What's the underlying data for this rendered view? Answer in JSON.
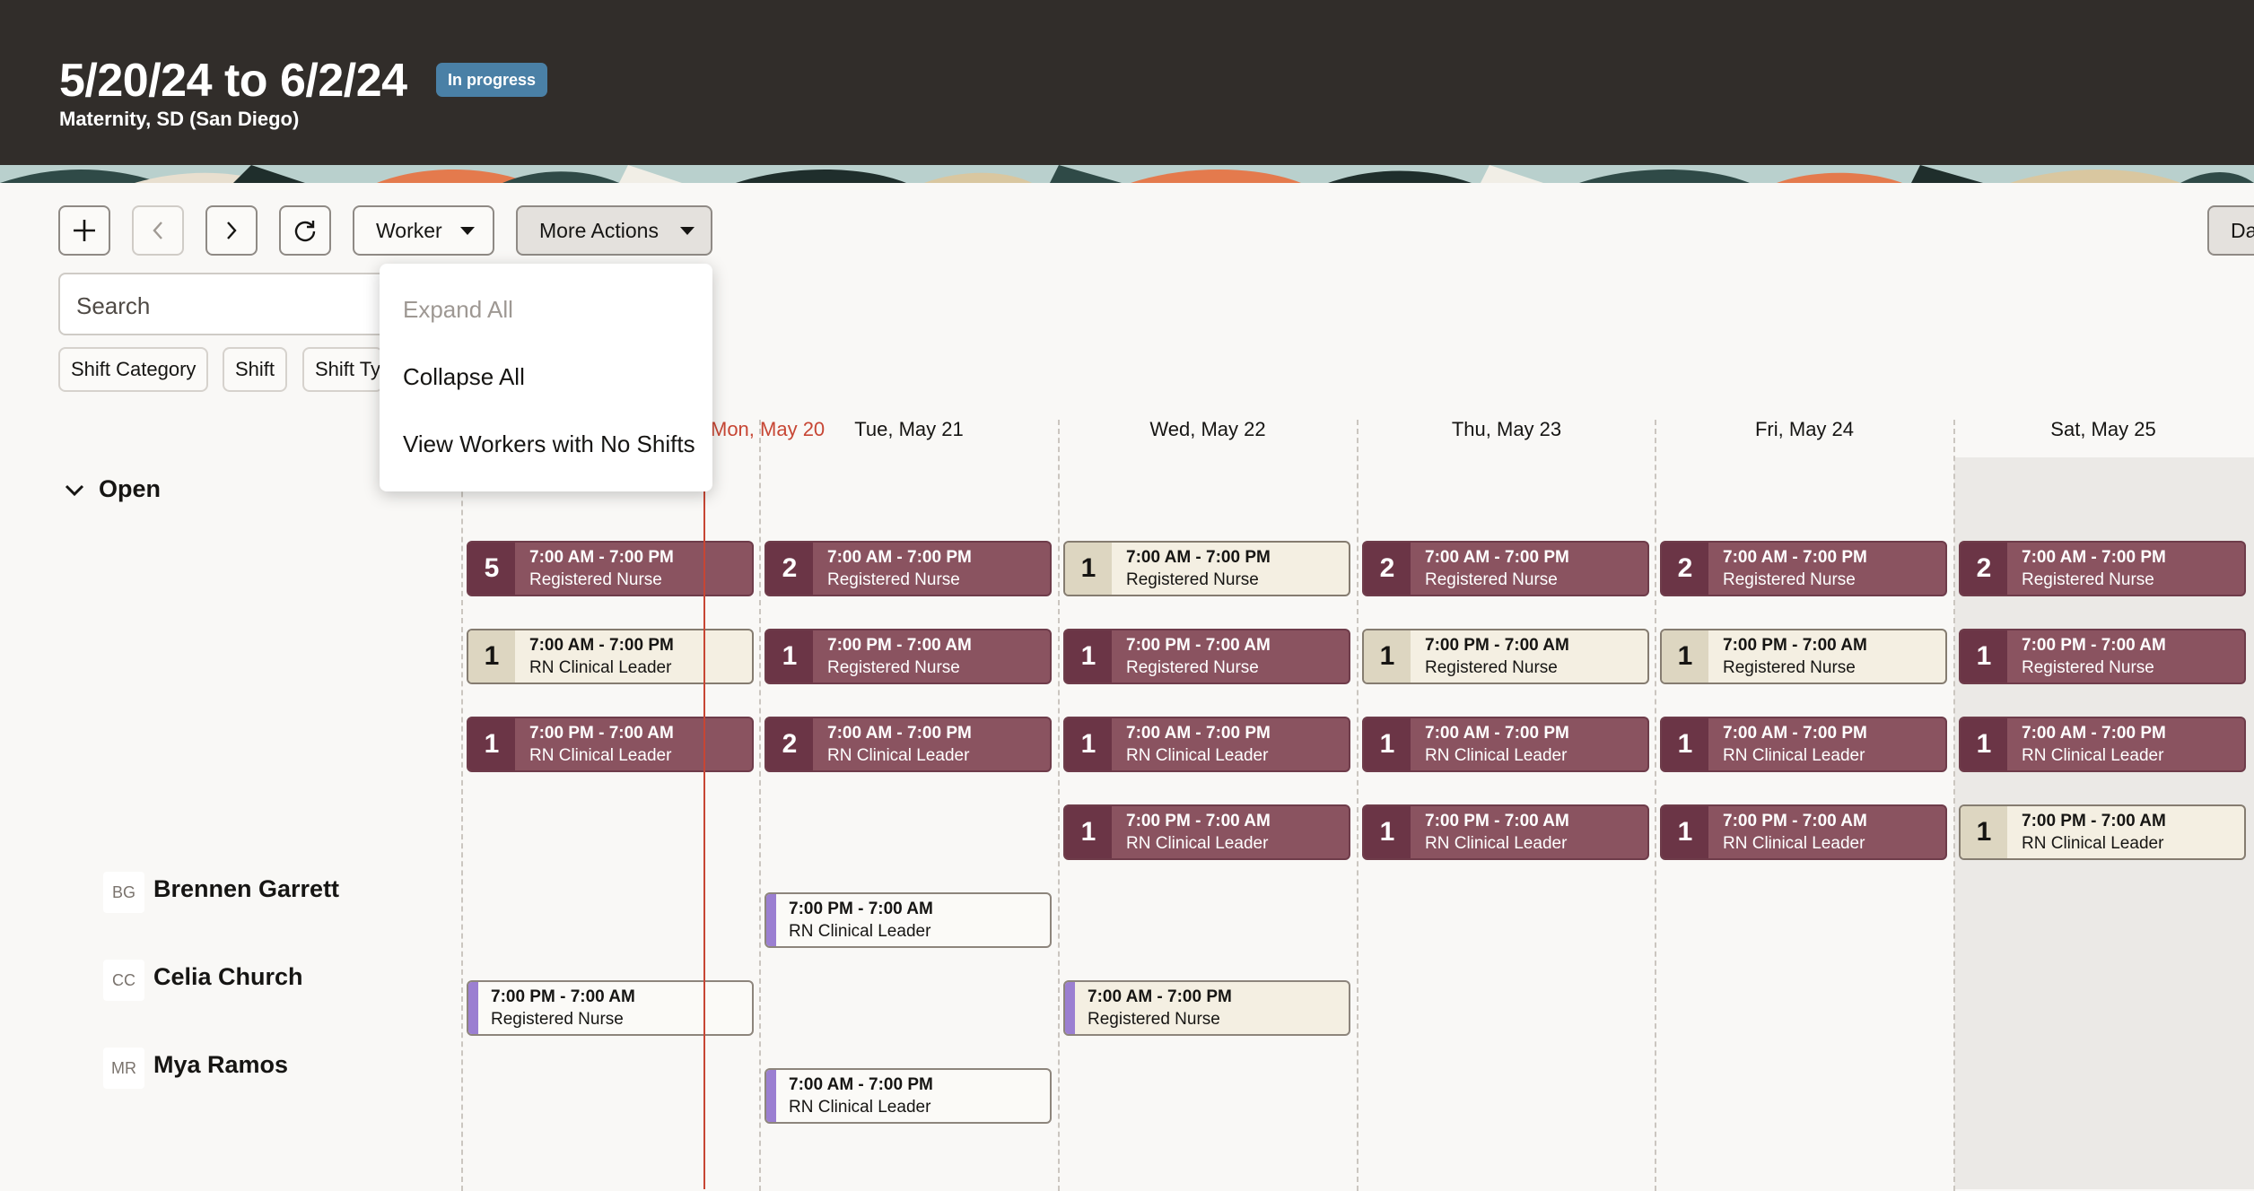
{
  "header": {
    "title": "5/20/24 to 6/2/24",
    "status_badge": "In progress",
    "subtitle": "Maternity, SD (San Diego)"
  },
  "toolbar": {
    "add_icon": "plus-icon",
    "prev_icon": "chevron-left-icon",
    "next_icon": "chevron-right-icon",
    "refresh_icon": "refresh-icon",
    "view_select": "Worker",
    "more_actions": "More Actions",
    "right_button_partial": "Da"
  },
  "search": {
    "placeholder": "Search"
  },
  "filters": [
    "Shift Category",
    "Shift",
    "Shift Ty"
  ],
  "more_actions_menu": {
    "items": [
      {
        "label": "Expand All",
        "disabled": true
      },
      {
        "label": "Collapse All",
        "disabled": false
      },
      {
        "label": "View Workers with No Shifts",
        "disabled": false
      }
    ]
  },
  "days": [
    {
      "label": "Mon, May 20",
      "today": true
    },
    {
      "label": "Tue, May 21"
    },
    {
      "label": "Wed, May 22"
    },
    {
      "label": "Thu, May 23"
    },
    {
      "label": "Fri, May 24"
    },
    {
      "label": "Sat, May 25"
    }
  ],
  "open_section": {
    "label": "Open",
    "rows": [
      [
        {
          "count": "5",
          "time": "7:00 AM - 7:00 PM",
          "role": "Registered Nurse",
          "style": "red"
        },
        {
          "count": "2",
          "time": "7:00 AM - 7:00 PM",
          "role": "Registered Nurse",
          "style": "red"
        },
        {
          "count": "1",
          "time": "7:00 AM - 7:00 PM",
          "role": "Registered Nurse",
          "style": "beige"
        },
        {
          "count": "2",
          "time": "7:00 AM - 7:00 PM",
          "role": "Registered Nurse",
          "style": "red"
        },
        {
          "count": "2",
          "time": "7:00 AM - 7:00 PM",
          "role": "Registered Nurse",
          "style": "red"
        },
        {
          "count": "2",
          "time": "7:00 AM - 7:00 PM",
          "role": "Registered Nurse",
          "style": "red"
        }
      ],
      [
        {
          "count": "1",
          "time": "7:00 AM - 7:00 PM",
          "role": "RN Clinical Leader",
          "style": "beige"
        },
        {
          "count": "1",
          "time": "7:00 PM - 7:00 AM",
          "role": "Registered Nurse",
          "style": "red"
        },
        {
          "count": "1",
          "time": "7:00 PM - 7:00 AM",
          "role": "Registered Nurse",
          "style": "red"
        },
        {
          "count": "1",
          "time": "7:00 PM - 7:00 AM",
          "role": "Registered Nurse",
          "style": "beige"
        },
        {
          "count": "1",
          "time": "7:00 PM - 7:00 AM",
          "role": "Registered Nurse",
          "style": "beige"
        },
        {
          "count": "1",
          "time": "7:00 PM - 7:00 AM",
          "role": "Registered Nurse",
          "style": "red"
        }
      ],
      [
        {
          "count": "1",
          "time": "7:00 PM - 7:00 AM",
          "role": "RN Clinical Leader",
          "style": "red"
        },
        {
          "count": "2",
          "time": "7:00 AM - 7:00 PM",
          "role": "RN Clinical Leader",
          "style": "red"
        },
        {
          "count": "1",
          "time": "7:00 AM - 7:00 PM",
          "role": "RN Clinical Leader",
          "style": "red"
        },
        {
          "count": "1",
          "time": "7:00 AM - 7:00 PM",
          "role": "RN Clinical Leader",
          "style": "red"
        },
        {
          "count": "1",
          "time": "7:00 AM - 7:00 PM",
          "role": "RN Clinical Leader",
          "style": "red"
        },
        {
          "count": "1",
          "time": "7:00 AM - 7:00 PM",
          "role": "RN Clinical Leader",
          "style": "red"
        }
      ],
      [
        null,
        null,
        {
          "count": "1",
          "time": "7:00 PM - 7:00 AM",
          "role": "RN Clinical Leader",
          "style": "red"
        },
        {
          "count": "1",
          "time": "7:00 PM - 7:00 AM",
          "role": "RN Clinical Leader",
          "style": "red"
        },
        {
          "count": "1",
          "time": "7:00 PM - 7:00 AM",
          "role": "RN Clinical Leader",
          "style": "red"
        },
        {
          "count": "1",
          "time": "7:00 PM - 7:00 AM",
          "role": "RN Clinical Leader",
          "style": "beige"
        }
      ]
    ]
  },
  "workers": [
    {
      "initials": "BG",
      "name": "Brennen Garrett",
      "shifts": [
        {
          "day": 1,
          "time": "7:00 PM - 7:00 AM",
          "role": "RN Clinical Leader",
          "style": "worker"
        }
      ]
    },
    {
      "initials": "CC",
      "name": "Celia Church",
      "shifts": [
        {
          "day": 0,
          "time": "7:00 PM - 7:00 AM",
          "role": "Registered Nurse",
          "style": "worker"
        },
        {
          "day": 2,
          "time": "7:00 AM - 7:00 PM",
          "role": "Registered Nurse",
          "style": "worker-beige"
        }
      ]
    },
    {
      "initials": "MR",
      "name": "Mya Ramos",
      "shifts": [
        {
          "day": 1,
          "time": "7:00 AM - 7:00 PM",
          "role": "RN Clinical Leader",
          "style": "worker"
        }
      ]
    }
  ],
  "colors": {
    "header_bg": "#312d2a",
    "badge": "#4a80a6",
    "open_shift_fill": "#8a5360",
    "open_shift_count": "#6b3546",
    "partial_shift_fill": "#f4efe2",
    "worker_accent": "#9b7fd1",
    "today": "#c74634"
  }
}
